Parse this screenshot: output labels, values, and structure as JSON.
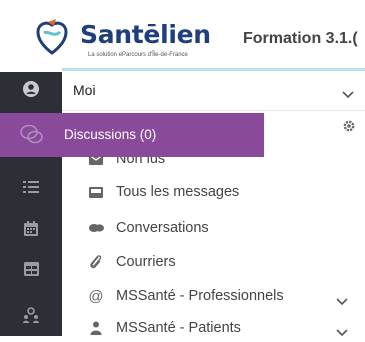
{
  "header": {
    "logo_text": "Santēlien",
    "logo_tagline": "La solution eParcours d'Île-de-France",
    "version_label": "Formation 3.1.("
  },
  "mailbox_select": {
    "label": "Moi"
  },
  "tooltip": {
    "label": "Discussions (0)"
  },
  "menu": {
    "items": [
      {
        "label": "Non lus"
      },
      {
        "label": "Tous les messages"
      },
      {
        "label": "Conversations"
      },
      {
        "label": "Courriers"
      },
      {
        "label": "MSSanté - Professionnels"
      },
      {
        "label": "MSSanté - Patients"
      }
    ]
  },
  "colors": {
    "accent_purple": "#8a4a9a",
    "nav_dark": "#2d2f36",
    "brand_navy": "#1f3f7a",
    "header_line": "#b7e2e7"
  },
  "icons": {
    "nav": [
      "user-icon",
      "chat-icon",
      "list-icon",
      "calendar-icon",
      "table-icon",
      "people-icon"
    ],
    "menu": [
      "envelope-icon",
      "inbox-icon",
      "conversation-icon",
      "paperclip-icon",
      "at-icon",
      "patient-icon"
    ]
  }
}
